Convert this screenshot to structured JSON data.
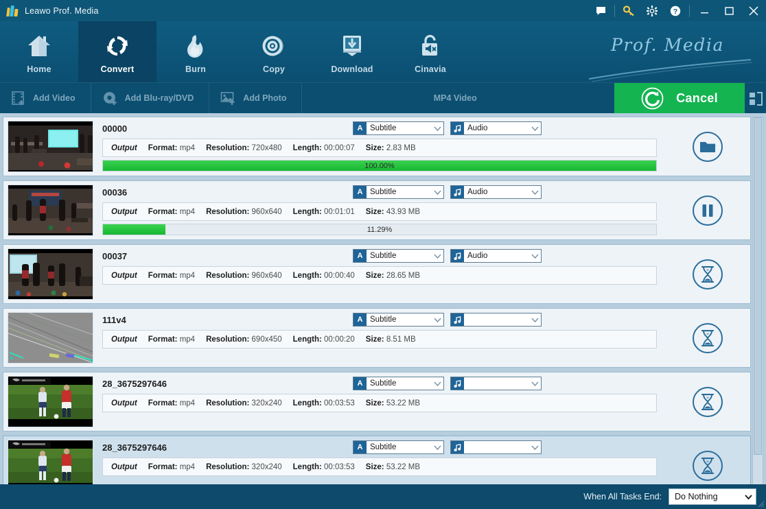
{
  "window": {
    "title": "Leawo Prof. Media",
    "logo_icon": "leawo-bars-logo",
    "title_buttons": [
      {
        "name": "feedback-icon",
        "label": "Feedback"
      },
      {
        "name": "key-icon",
        "label": "Register"
      },
      {
        "name": "gear-icon",
        "label": "Settings"
      },
      {
        "name": "help-icon",
        "label": "Help"
      }
    ],
    "window_buttons": [
      {
        "name": "minimize-button",
        "glyph": "minimize"
      },
      {
        "name": "maximize-button",
        "glyph": "maximize"
      },
      {
        "name": "close-button",
        "glyph": "close"
      }
    ]
  },
  "nav": {
    "items": [
      {
        "label": "Home",
        "icon": "home-icon",
        "active": false
      },
      {
        "label": "Convert",
        "icon": "convert-icon",
        "active": true
      },
      {
        "label": "Burn",
        "icon": "flame-icon",
        "active": false
      },
      {
        "label": "Copy",
        "icon": "disc-icon",
        "active": false
      },
      {
        "label": "Download",
        "icon": "download-icon",
        "active": false
      },
      {
        "label": "Cinavia",
        "icon": "cinavia-icon",
        "active": false
      }
    ],
    "brand_text": "Prof. Media"
  },
  "toolbar": {
    "add_video": "Add Video",
    "add_bluray": "Add Blu-ray/DVD",
    "add_photo": "Add Photo",
    "profile_label": "MP4 Video",
    "cancel_label": "Cancel",
    "cancel_icon": "cancel-refresh-icon",
    "expand_icon": "expand-icon"
  },
  "colors": {
    "accent_green": "#14b451",
    "progress_green": "#22c03c",
    "titlebar_blue": "#0e5677",
    "nav_active": "#0a4363",
    "list_bg": "#b6cddd"
  },
  "list": {
    "output_label": "Output",
    "field_labels": {
      "format": "Format:",
      "resolution": "Resolution:",
      "length": "Length:",
      "size": "Size:"
    },
    "subtitle_icon": "subtitle-A-icon",
    "audio_icon": "audio-note-icon",
    "tasks": [
      {
        "name": "00000",
        "subtitle": "Subtitle",
        "audio": "Audio",
        "format": "mp4",
        "resolution": "720x480",
        "length": "00:00:07",
        "size": "2.83 MB",
        "progress": 100.0,
        "progress_text": "100.00%",
        "has_progress": true,
        "action_icon": "open-folder-icon",
        "selected": false,
        "thumb": "conference-screen"
      },
      {
        "name": "00036",
        "subtitle": "Subtitle",
        "audio": "Audio",
        "format": "mp4",
        "resolution": "960x640",
        "length": "00:01:01",
        "size": "43.93 MB",
        "progress": 11.29,
        "progress_text": "11.29%",
        "has_progress": true,
        "action_icon": "pause-icon",
        "selected": false,
        "thumb": "stage-dancers"
      },
      {
        "name": "00037",
        "subtitle": "Subtitle",
        "audio": "Audio",
        "format": "mp4",
        "resolution": "960x640",
        "length": "00:00:40",
        "size": "28.65 MB",
        "progress": 0,
        "progress_text": "",
        "has_progress": false,
        "action_icon": "hourglass-icon",
        "selected": false,
        "thumb": "stage-group"
      },
      {
        "name": "111v4",
        "subtitle": "Subtitle",
        "audio": "",
        "format": "mp4",
        "resolution": "690x450",
        "length": "00:00:20",
        "size": "8.51 MB",
        "progress": 0,
        "progress_text": "",
        "has_progress": false,
        "action_icon": "hourglass-icon",
        "selected": false,
        "thumb": "gray-lines"
      },
      {
        "name": "28_3675297646",
        "subtitle": "Subtitle",
        "audio": "",
        "format": "mp4",
        "resolution": "320x240",
        "length": "00:03:53",
        "size": "53.22 MB",
        "progress": 0,
        "progress_text": "",
        "has_progress": false,
        "action_icon": "hourglass-icon",
        "selected": false,
        "thumb": "soccer"
      },
      {
        "name": "28_3675297646",
        "subtitle": "Subtitle",
        "audio": "",
        "format": "mp4",
        "resolution": "320x240",
        "length": "00:03:53",
        "size": "53.22 MB",
        "progress": 0,
        "progress_text": "",
        "has_progress": false,
        "action_icon": "hourglass-icon",
        "selected": true,
        "thumb": "soccer"
      }
    ]
  },
  "statusbar": {
    "when_all_tasks_end_label": "When All Tasks End:",
    "when_all_tasks_end_value": "Do Nothing"
  }
}
